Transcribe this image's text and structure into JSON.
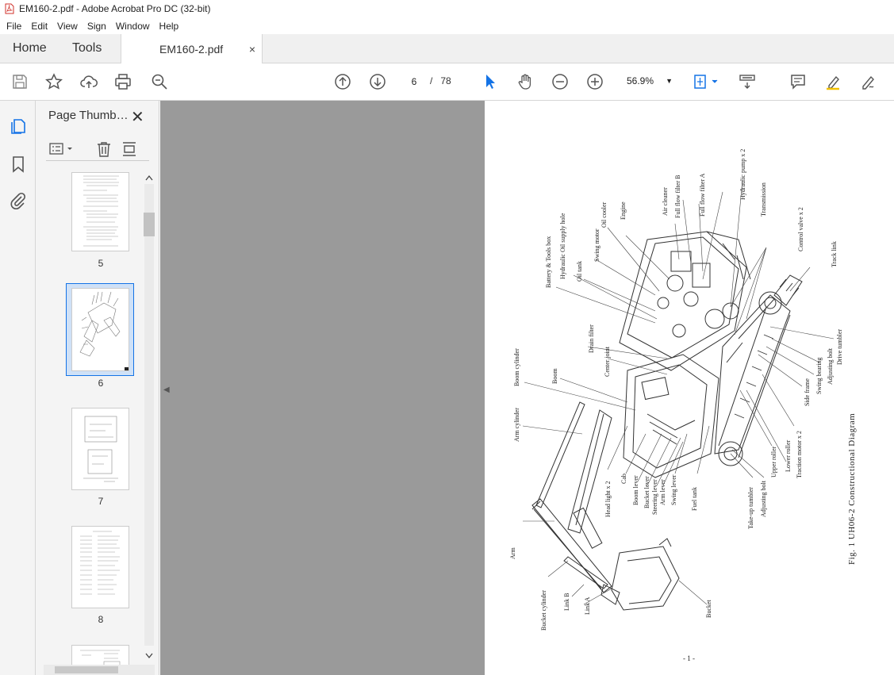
{
  "window": {
    "title": "EM160-2.pdf - Adobe Acrobat Pro DC (32-bit)"
  },
  "menu": [
    "File",
    "Edit",
    "View",
    "Sign",
    "Window",
    "Help"
  ],
  "tabs": {
    "home": "Home",
    "tools": "Tools",
    "doc": "EM160-2.pdf",
    "close": "×"
  },
  "nav": {
    "current_page": "6",
    "separator": "/",
    "total_pages": "78"
  },
  "zoom": {
    "value": "56.9%"
  },
  "panel": {
    "title": "Page Thumb…",
    "close": "✕"
  },
  "thumbnails": [
    {
      "label": "5"
    },
    {
      "label": "6"
    },
    {
      "label": "7"
    },
    {
      "label": "8"
    }
  ],
  "document": {
    "figure_title": "Fig. 1  UH06-2 Constructional Diagram",
    "page_number": "- 1 -",
    "labels": {
      "battery": "Battery & Tools box",
      "hyd_oil_supply": "Hydraulic Oil supply hole",
      "oil_tank": "Oil tank",
      "swing_motor": "Swing motor",
      "oil_cooler": "Oil cooler",
      "engine": "Engine",
      "air_cleaner": "Air cleaner",
      "ff_b": "Full flow filter B",
      "ff_a": "Full flow filter A",
      "hyd_pump": "Hydraulic pump x 2",
      "transmission": "Transmission",
      "control_valve": "Control valve x 2",
      "track_link": "Track link",
      "drain_filter": "Drain filter",
      "center_joint": "Center joint",
      "boom_cylinder": "Boom cylinder",
      "boom": "Boom",
      "arm_cylinder": "Arm cylinder",
      "arm": "Arm",
      "bucket_cylinder": "Bucket cylinder",
      "link_b": "Link B",
      "link_a": "Link A",
      "head_light": "Head light x 2",
      "cab": "Cab",
      "boom_lever": "Boom lever",
      "bucket_lever": "Bucket lever",
      "steering_lever": "Steering lever",
      "arm_lever": "Arm lever",
      "swing_lever": "Swing lever",
      "fuel_tank": "Fuel tank",
      "take_up": "Take-up tumbler",
      "adjusting_bolt": "Adjusting bolt",
      "upper_roller": "Upper roller",
      "lower_roller": "Lower roller",
      "traction_motor": "Traction motor x 2",
      "side_frame": "Side frame",
      "swing_bearing": "Swing bearing",
      "adjusting_bolt_2": "Adjusting bolt",
      "drive_tumbler": "Drive tumbler",
      "bucket": "Bucket"
    }
  }
}
